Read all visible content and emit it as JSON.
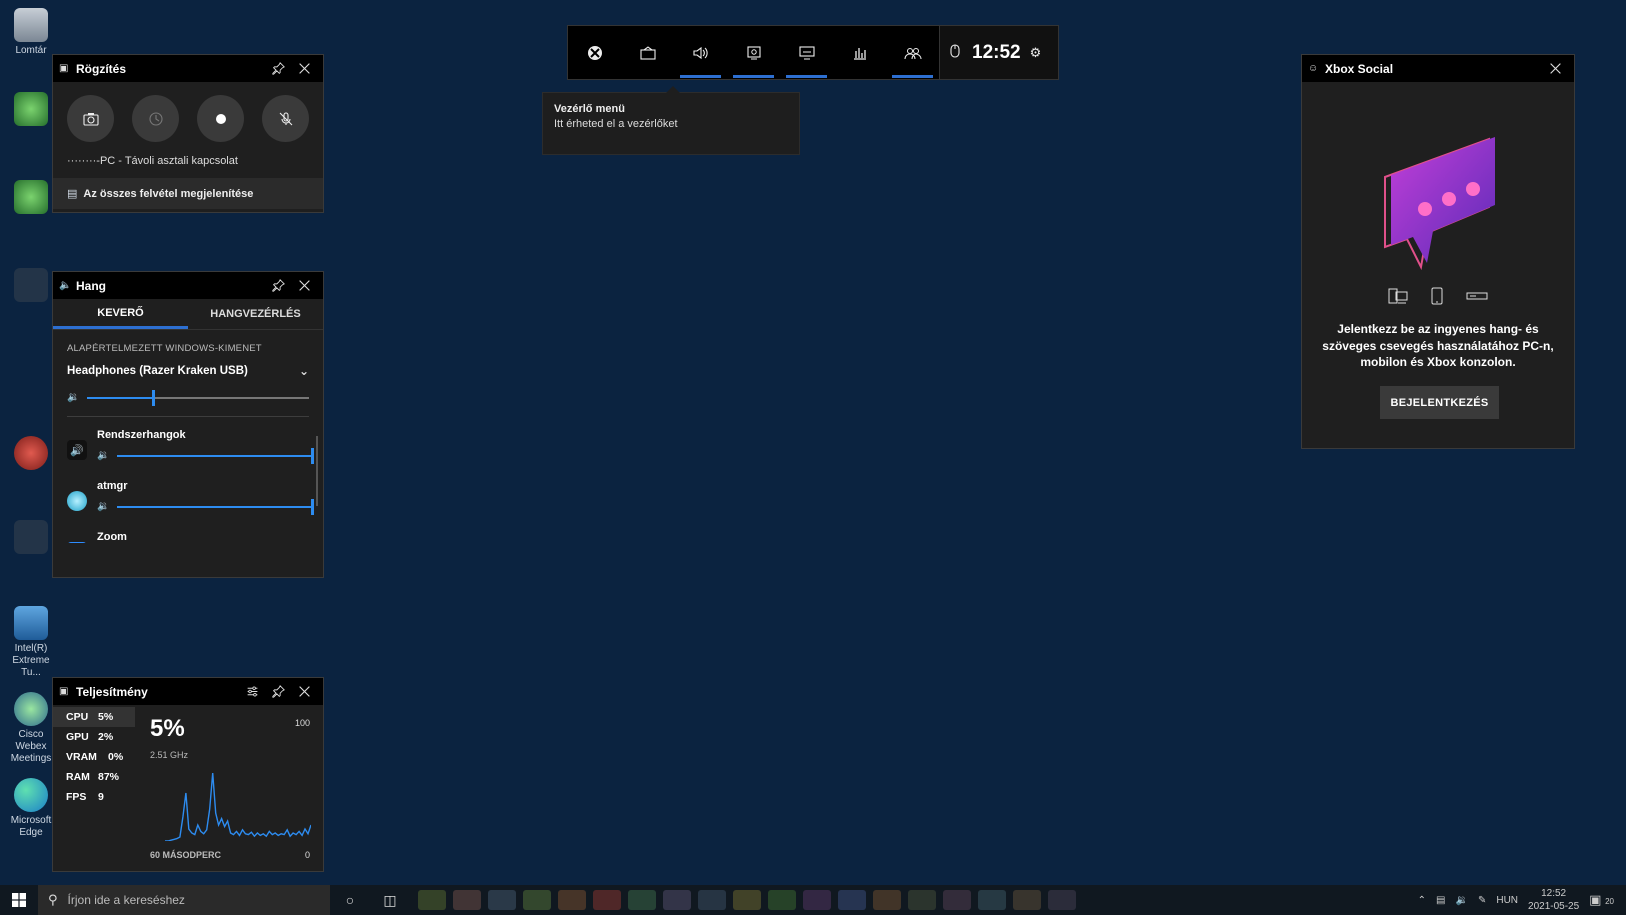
{
  "desktop": {
    "icons": [
      {
        "label": "Lomtár"
      },
      {
        "label": ""
      },
      {
        "label": ""
      },
      {
        "label": ""
      },
      {
        "label": ""
      },
      {
        "label": ""
      },
      {
        "label": "Intel(R) Extreme Tu..."
      },
      {
        "label": "Cisco Webex Meetings"
      },
      {
        "label": "Microsoft Edge"
      }
    ]
  },
  "capture": {
    "title": "Rögzítés",
    "session": "········-PC - Távoli asztali kapcsolat",
    "show_all": "Az összes felvétel megjelenítése"
  },
  "audio": {
    "title": "Hang",
    "tabs": [
      "KEVERŐ",
      "HANGVEZÉRLÉS"
    ],
    "section_label": "ALAPÉRTELMEZETT WINDOWS-KIMENET",
    "device": "Headphones (Razer Kraken USB)",
    "master_volume": 0.3,
    "apps": [
      {
        "name": "Rendszerhangok",
        "volume": 1.0
      },
      {
        "name": "atmgr",
        "volume": 1.0
      },
      {
        "name": "Zoom",
        "volume": 1.0
      }
    ]
  },
  "performance": {
    "title": "Teljesítmény",
    "metrics": [
      {
        "key": "CPU",
        "value": "5%"
      },
      {
        "key": "GPU",
        "value": "2%"
      },
      {
        "key": "VRAM",
        "value": "0%"
      },
      {
        "key": "RAM",
        "value": "87%"
      },
      {
        "key": "FPS",
        "value": "9"
      }
    ],
    "big_value": "5%",
    "frequency": "2.51 GHz",
    "max_label": "100",
    "min_label": "0",
    "axis_label": "60 MÁSODPERC",
    "series": [
      0,
      0,
      1,
      2,
      3,
      5,
      30,
      60,
      15,
      10,
      8,
      20,
      12,
      9,
      14,
      40,
      85,
      35,
      20,
      28,
      18,
      25,
      10,
      8,
      12,
      7,
      14,
      9,
      8,
      11,
      6,
      10,
      7,
      9,
      6,
      12,
      8,
      10,
      7,
      9,
      8,
      14,
      6,
      10,
      8,
      12,
      7,
      15,
      9,
      20
    ]
  },
  "gamebar": {
    "clock": "12:52",
    "buttons": [
      "xbox-icon",
      "widget-store-icon",
      "audio-icon",
      "capture-icon",
      "resources-icon",
      "performance-icon",
      "social-icon"
    ]
  },
  "tooltip": {
    "title": "Vezérlő menü",
    "text": "Itt érheted el a vezérlőket"
  },
  "social": {
    "title": "Xbox Social",
    "message": "Jelentkezz be az ingyenes hang- és szöveges csevegés használatához PC-n, mobilon és Xbox konzolon.",
    "signin": "BEJELENTKEZÉS"
  },
  "taskbar": {
    "search_placeholder": "Írjon ide a kereséshez",
    "language": "HUN",
    "time": "12:52",
    "date": "2021-05-25",
    "notifications": "20"
  },
  "colors": {
    "accent": "#2d8cf0",
    "background": "#0b2340",
    "social_bubble": "#b04fd0"
  }
}
